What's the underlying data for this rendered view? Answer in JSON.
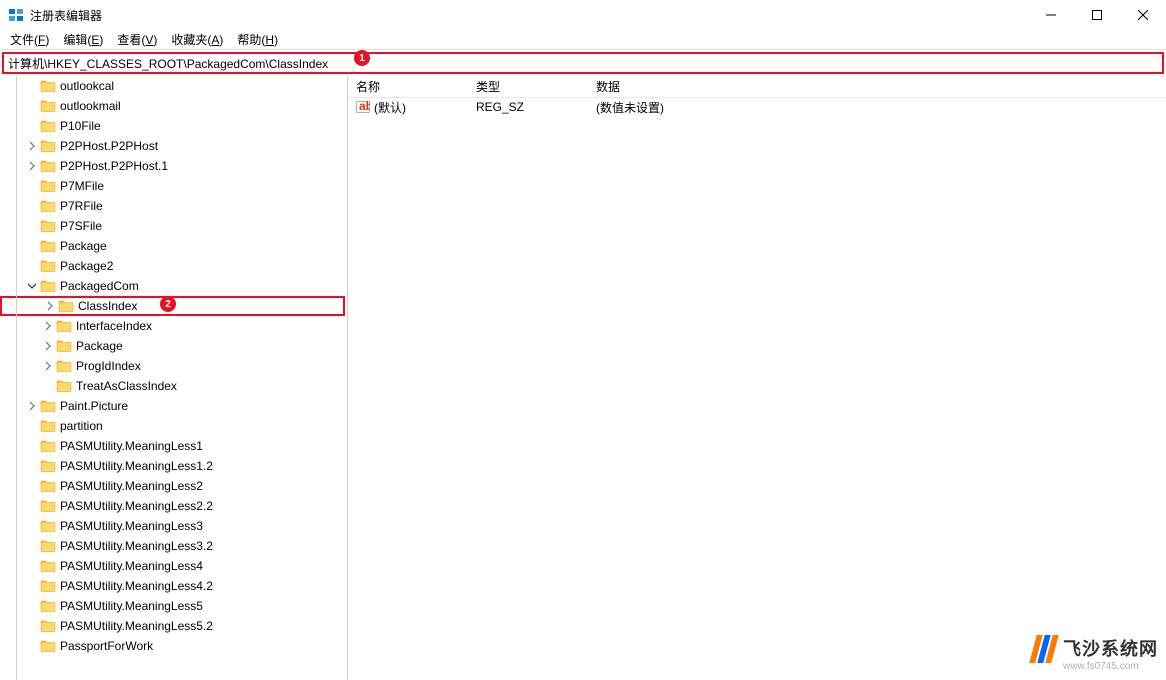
{
  "window": {
    "title": "注册表编辑器"
  },
  "menu": {
    "file": "文件(F)",
    "edit": "编辑(E)",
    "view": "查看(V)",
    "favorites": "收藏夹(A)",
    "help": "帮助(H)"
  },
  "address": "计算机\\HKEY_CLASSES_ROOT\\PackagedCom\\ClassIndex",
  "callouts": {
    "one": "1",
    "two": "2"
  },
  "tree": [
    {
      "label": "outlookcal",
      "level": 2,
      "expandable": false
    },
    {
      "label": "outlookmail",
      "level": 2,
      "expandable": false
    },
    {
      "label": "P10File",
      "level": 2,
      "expandable": false
    },
    {
      "label": "P2PHost.P2PHost",
      "level": 2,
      "expandable": true,
      "state": "closed"
    },
    {
      "label": "P2PHost.P2PHost.1",
      "level": 2,
      "expandable": true,
      "state": "closed"
    },
    {
      "label": "P7MFile",
      "level": 2,
      "expandable": false
    },
    {
      "label": "P7RFile",
      "level": 2,
      "expandable": false
    },
    {
      "label": "P7SFile",
      "level": 2,
      "expandable": false
    },
    {
      "label": "Package",
      "level": 2,
      "expandable": false
    },
    {
      "label": "Package2",
      "level": 2,
      "expandable": false
    },
    {
      "label": "PackagedCom",
      "level": 2,
      "expandable": true,
      "state": "open"
    },
    {
      "label": "ClassIndex",
      "level": 3,
      "expandable": true,
      "state": "closed",
      "highlighted": true
    },
    {
      "label": "InterfaceIndex",
      "level": 3,
      "expandable": true,
      "state": "closed"
    },
    {
      "label": "Package",
      "level": 3,
      "expandable": true,
      "state": "closed"
    },
    {
      "label": "ProgIdIndex",
      "level": 3,
      "expandable": true,
      "state": "closed"
    },
    {
      "label": "TreatAsClassIndex",
      "level": 3,
      "expandable": false
    },
    {
      "label": "Paint.Picture",
      "level": 2,
      "expandable": true,
      "state": "closed"
    },
    {
      "label": "partition",
      "level": 2,
      "expandable": false
    },
    {
      "label": "PASMUtility.MeaningLess1",
      "level": 2,
      "expandable": false
    },
    {
      "label": "PASMUtility.MeaningLess1.2",
      "level": 2,
      "expandable": false
    },
    {
      "label": "PASMUtility.MeaningLess2",
      "level": 2,
      "expandable": false
    },
    {
      "label": "PASMUtility.MeaningLess2.2",
      "level": 2,
      "expandable": false
    },
    {
      "label": "PASMUtility.MeaningLess3",
      "level": 2,
      "expandable": false
    },
    {
      "label": "PASMUtility.MeaningLess3.2",
      "level": 2,
      "expandable": false
    },
    {
      "label": "PASMUtility.MeaningLess4",
      "level": 2,
      "expandable": false
    },
    {
      "label": "PASMUtility.MeaningLess4.2",
      "level": 2,
      "expandable": false
    },
    {
      "label": "PASMUtility.MeaningLess5",
      "level": 2,
      "expandable": false
    },
    {
      "label": "PASMUtility.MeaningLess5.2",
      "level": 2,
      "expandable": false
    },
    {
      "label": "PassportForWork",
      "level": 2,
      "expandable": false
    }
  ],
  "columns": {
    "name": "名称",
    "type": "类型",
    "data": "数据"
  },
  "values": [
    {
      "name": "(默认)",
      "type": "REG_SZ",
      "data": "(数值未设置)"
    }
  ],
  "watermark": {
    "cn": "飞沙系统网",
    "url": "www.fs0745.com"
  }
}
